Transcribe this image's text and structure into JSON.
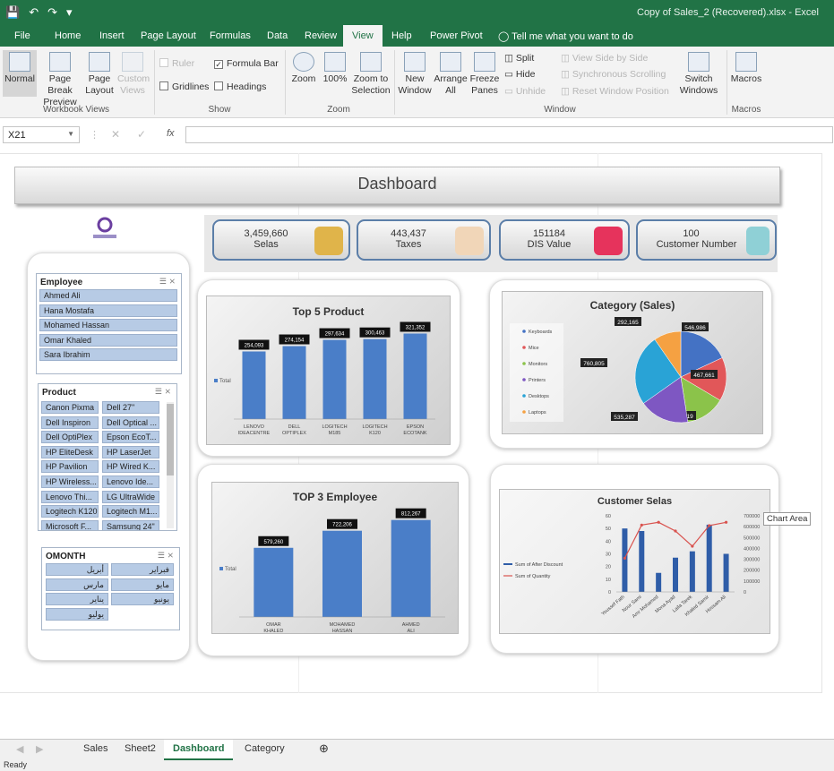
{
  "window": {
    "title": "Copy of Sales_2 (Recovered).xlsx - Excel"
  },
  "menu": {
    "tabs": [
      "File",
      "Home",
      "Insert",
      "Page Layout",
      "Formulas",
      "Data",
      "Review",
      "View",
      "Help",
      "Power Pivot"
    ],
    "active": "View",
    "tell_me": "Tell me what you want to do"
  },
  "ribbon": {
    "workbook_views": {
      "normal": "Normal",
      "page_break": "Page Break Preview",
      "page_layout": "Page Layout",
      "custom_views": "Custom Views",
      "label": "Workbook Views"
    },
    "show": {
      "ruler": "Ruler",
      "formula_bar": "Formula Bar",
      "gridlines": "Gridlines",
      "headings": "Headings",
      "label": "Show"
    },
    "zoom": {
      "zoom": "Zoom",
      "hundred": "100%",
      "zoom_to_selection": "Zoom to Selection",
      "label": "Zoom"
    },
    "window": {
      "new_window": "New Window",
      "arrange_all": "Arrange All",
      "freeze_panes": "Freeze Panes",
      "split": "Split",
      "hide": "Hide",
      "unhide": "Unhide",
      "side_by_side": "View Side by Side",
      "sync_scroll": "Synchronous Scrolling",
      "reset_pos": "Reset Window Position",
      "switch": "Switch Windows",
      "label": "Window"
    },
    "macros": {
      "macros": "Macros",
      "label": "Macros"
    }
  },
  "formula_bar": {
    "name_box": "X21",
    "fx": "fx"
  },
  "dashboard": {
    "title": "Dashboard",
    "kpis": [
      {
        "value": "3,459,660",
        "label": "Selas"
      },
      {
        "value": "443,437",
        "label": "Taxes"
      },
      {
        "value": "151184",
        "label": "DIS Value"
      },
      {
        "value": "100",
        "label": "Customer Number"
      }
    ],
    "slicers": {
      "employee": {
        "header": "Employee",
        "items": [
          "Ahmed Ali",
          "Hana Mostafa",
          "Mohamed Hassan",
          "Omar Khaled",
          "Sara Ibrahim"
        ]
      },
      "product": {
        "header": "Product",
        "items": [
          "Canon Pixma",
          "Dell 27\"",
          "Dell Inspiron",
          "Dell Optical ...",
          "Dell OptiPlex",
          "Epson EcoT...",
          "HP EliteDesk",
          "HP LaserJet",
          "HP Pavilion",
          "HP Wired K...",
          "HP Wireless...",
          "Lenovo Ide...",
          "Lenovo Thi...",
          "LG UltraWide",
          "Logitech K120",
          "Logitech M1...",
          "Microsoft F...",
          "Samsung 24\""
        ]
      },
      "month": {
        "header": "OMONTH",
        "items": [
          "أبريل",
          "فبراير",
          "مارس",
          "مايو",
          "يناير",
          "يونيو",
          "يوليو"
        ]
      }
    }
  },
  "chart_data": [
    {
      "type": "bar",
      "title": "Top 5 Product",
      "categories": [
        "LENOVO IDEACENTRE",
        "DELL OPTIPLEX",
        "LOGITECH M185",
        "LOGITECH K120",
        "EPSON ECOTANK"
      ],
      "values": [
        254093,
        274154,
        297634,
        300463,
        321352
      ],
      "data_labels": [
        "254,093",
        "274,154",
        "297,634",
        "300,463",
        "321,352"
      ],
      "legend": "Total",
      "ylim": [
        0,
        360000
      ]
    },
    {
      "type": "pie",
      "title": "Category  (Sales)",
      "categories": [
        "Keyboards",
        "Mice",
        "Monitors",
        "Printers",
        "Desktops",
        "Laptops"
      ],
      "values": [
        546986,
        467661,
        423319,
        535287,
        760805,
        292165
      ],
      "data_labels": [
        "546,986",
        "467,661",
        "423,319",
        "535,287",
        "760,805",
        "292,165"
      ],
      "colors": [
        "#4472c4",
        "#e15759",
        "#8bc34a",
        "#7e57c2",
        "#29a3d6",
        "#f5a142"
      ]
    },
    {
      "type": "bar",
      "title": "TOP 3 Employee",
      "categories": [
        "OMAR KHALED",
        "MOHAMED HASSAN",
        "AHMED ALI"
      ],
      "values": [
        579260,
        722206,
        812267
      ],
      "data_labels": [
        "579,260",
        "722,206",
        "812,267"
      ],
      "legend": "Total",
      "ylim": [
        0,
        900000
      ]
    },
    {
      "type": "bar",
      "title": "Customer Selas",
      "categories": [
        "Youssef Fath",
        "Nour Sami",
        "Amr Mohamed",
        "Mona Ayad",
        "Laila Tarek",
        "Khaled Samir",
        "Hossam Ali"
      ],
      "series": [
        {
          "name": "Sum of After Discount",
          "values": [
            50,
            48,
            15,
            27,
            32,
            53,
            30
          ]
        },
        {
          "name": "Sum of Quantity",
          "values": [
            310000,
            615000,
            640000,
            560000,
            420000,
            610000,
            640000
          ]
        }
      ],
      "y_left": {
        "ylim": [
          0,
          60
        ],
        "ticks": [
          "60",
          "50",
          "40",
          "30",
          "20",
          "10",
          "0"
        ]
      },
      "y_right": {
        "ylim": [
          0,
          700000
        ],
        "ticks": [
          "700000",
          "600000",
          "500000",
          "400000",
          "300000",
          "200000",
          "100000",
          "0"
        ]
      }
    }
  ],
  "tooltip": "Chart Area",
  "sheet_tabs": [
    "Sales",
    "Sheet2",
    "Dashboard",
    "Category"
  ],
  "active_sheet": "Dashboard",
  "status": "Ready"
}
